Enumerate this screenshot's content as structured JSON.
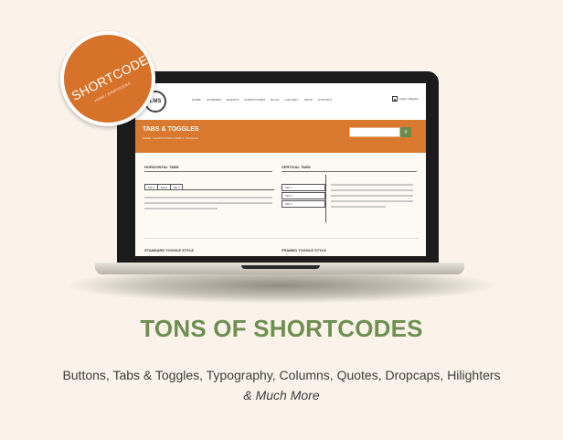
{
  "badge": {
    "title": "SHORTCODES",
    "subtitle": "HOME / SHORTCODES"
  },
  "site": {
    "logo": "LMS",
    "nav": [
      "HOME",
      "COURSES",
      "EVENTS",
      "SHORTCODES",
      "BLOG",
      "GALLERY",
      "SHOP",
      "CONTACT"
    ],
    "login": "Login / Register",
    "hero_title": "TABS & TOGGLES",
    "hero_crumb": "HOME / SHORTCODES / TABS & TOGGLES",
    "search_icon": "search-icon",
    "horizontal_tabs_heading": "HORIZONTAL TABS",
    "vertical_tabs_heading": "VERTICAL TABS",
    "htabs": [
      "Tab 1",
      "Tab 2",
      "Tab 3"
    ],
    "vtabs": [
      "Tab 1",
      "Tab 2",
      "Tab 3"
    ],
    "standard_toggle_heading": "STANDARD TOGGLE STYLE",
    "framed_toggle_heading": "FRAMED TOGGLE STYLE"
  },
  "headline": "TONS OF SHORTCODES",
  "subline": "Buttons, Tabs & Toggles, Typography, Columns, Quotes, Dropcaps, Hilighters",
  "more": "& Much More",
  "colors": {
    "accent_orange": "#d9782f",
    "accent_green": "#6e8f52",
    "background": "#fbf3ea"
  }
}
